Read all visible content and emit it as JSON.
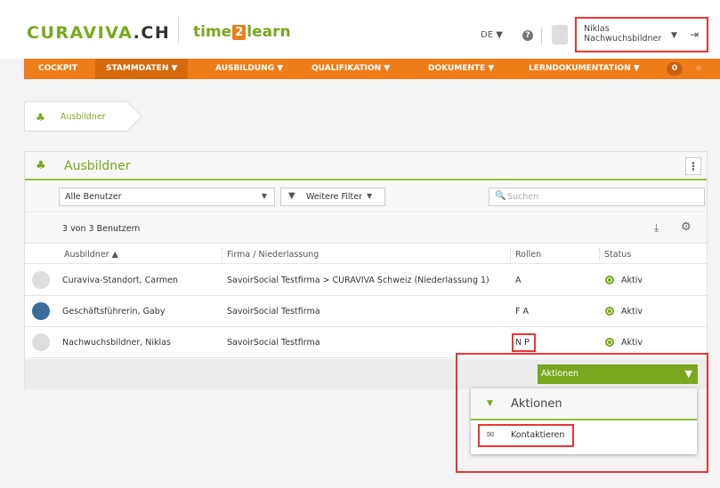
{
  "header": {
    "logo_main": "CURAVIVA",
    "logo_suffix": ".CH",
    "product_before": "time",
    "product_digit": "2",
    "product_after": "learn",
    "language": "DE ▼",
    "help_label": "?",
    "user_name": "Niklas Nachwuchsbildner",
    "user_caret": "▼",
    "logout_icon": "⇥"
  },
  "nav": {
    "items": [
      {
        "label": "COCKPIT"
      },
      {
        "label": "STAMMDATEN ▼"
      },
      {
        "label": "AUSBILDUNG ▼"
      },
      {
        "label": "QUALIFIKATION ▼"
      },
      {
        "label": "DOKUMENTE ▼"
      },
      {
        "label": "LERNDOKUMENTATION ▼"
      }
    ],
    "badge": "0",
    "star": "★"
  },
  "breadcrumb": {
    "label": "Ausbildner"
  },
  "panel": {
    "title": "Ausbildner",
    "menu_label": "⋮",
    "filter_select": "Alle Benutzer",
    "filter_caret": "▼",
    "more_filter": "Weitere Filter",
    "more_filter_caret": "▼",
    "search_placeholder": "Suchen",
    "count": "3 von 3 Benutzern",
    "columns": {
      "name": "Ausbildner ▲",
      "firm": "Firma / Niederlassung",
      "roles": "Rollen",
      "status": "Status"
    },
    "rows": [
      {
        "name": "Curaviva-Standort, Carmen",
        "firm": "SavoirSocial Testfirma > CURAVIVA Schweiz (Niederlassung 1)",
        "roles": "A",
        "status": "Aktiv"
      },
      {
        "name": "Geschäftsführerin, Gaby",
        "firm": "SavoirSocial Testfirma",
        "roles": "F A",
        "status": "Aktiv"
      },
      {
        "name": "Nachwuchsbildner, Niklas",
        "firm": "SavoirSocial Testfirma",
        "roles": "N P",
        "status": "Aktiv"
      }
    ]
  },
  "actions": {
    "button_label": "Aktionen",
    "button_caret": "▼",
    "dropdown_caret": "▼",
    "dropdown_title": "Aktionen",
    "items": [
      {
        "label": "Kontaktieren",
        "icon": "✉"
      }
    ]
  },
  "icons": {
    "user_group": "♣",
    "filter": "▼",
    "search": "🔍",
    "export": "⤓",
    "gear": "⚙"
  },
  "colors": {
    "brand_green": "#7aa71e",
    "nav_orange": "#ef7d1a",
    "highlight_red": "#e33"
  }
}
